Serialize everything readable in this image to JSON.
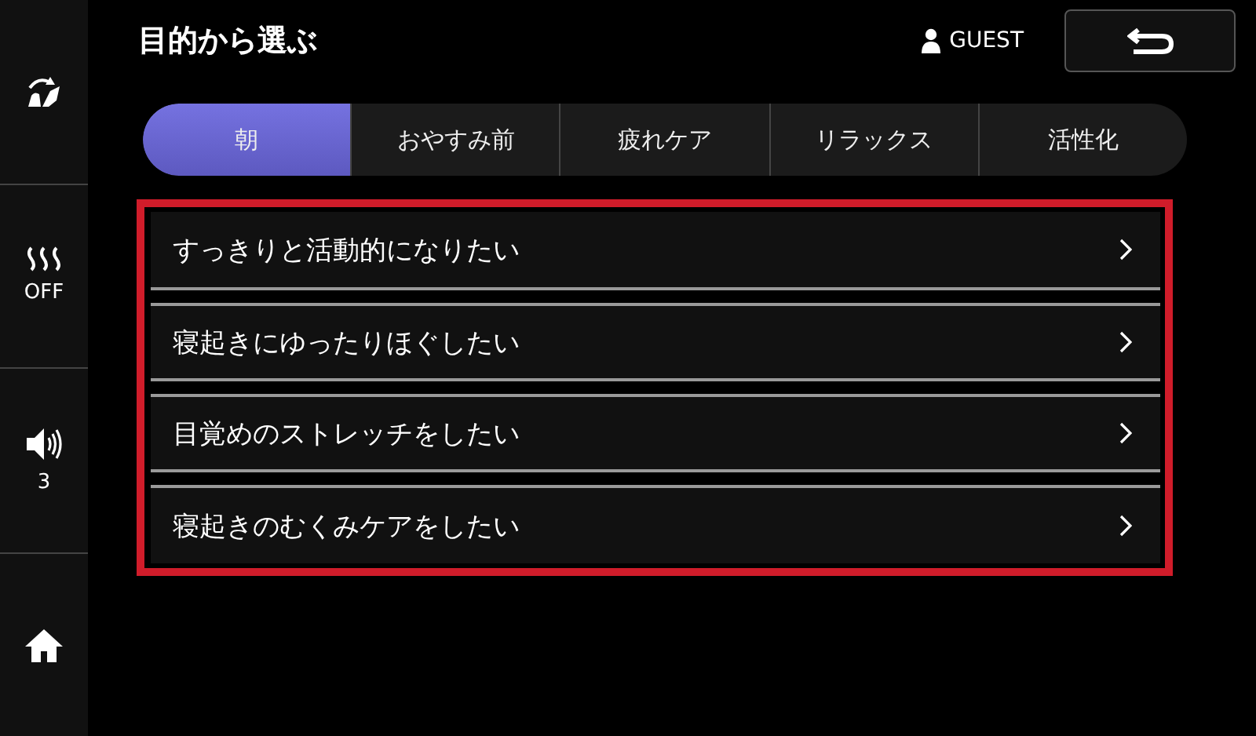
{
  "title": "目的から選ぶ",
  "user": {
    "name": "GUEST"
  },
  "sidebar": [
    {
      "kind": "seat"
    },
    {
      "kind": "heater",
      "label": "OFF"
    },
    {
      "kind": "volume",
      "label": "3"
    },
    {
      "kind": "home"
    }
  ],
  "tabs": [
    {
      "label": "朝",
      "selected": true
    },
    {
      "label": "おやすみ前",
      "selected": false
    },
    {
      "label": "疲れケア",
      "selected": false
    },
    {
      "label": "リラックス",
      "selected": false
    },
    {
      "label": "活性化",
      "selected": false
    }
  ],
  "items": [
    {
      "label": "すっきりと活動的になりたい"
    },
    {
      "label": "寝起きにゆったりほぐしたい"
    },
    {
      "label": "目覚めのストレッチをしたい"
    },
    {
      "label": "寝起きのむくみケアをしたい"
    }
  ]
}
